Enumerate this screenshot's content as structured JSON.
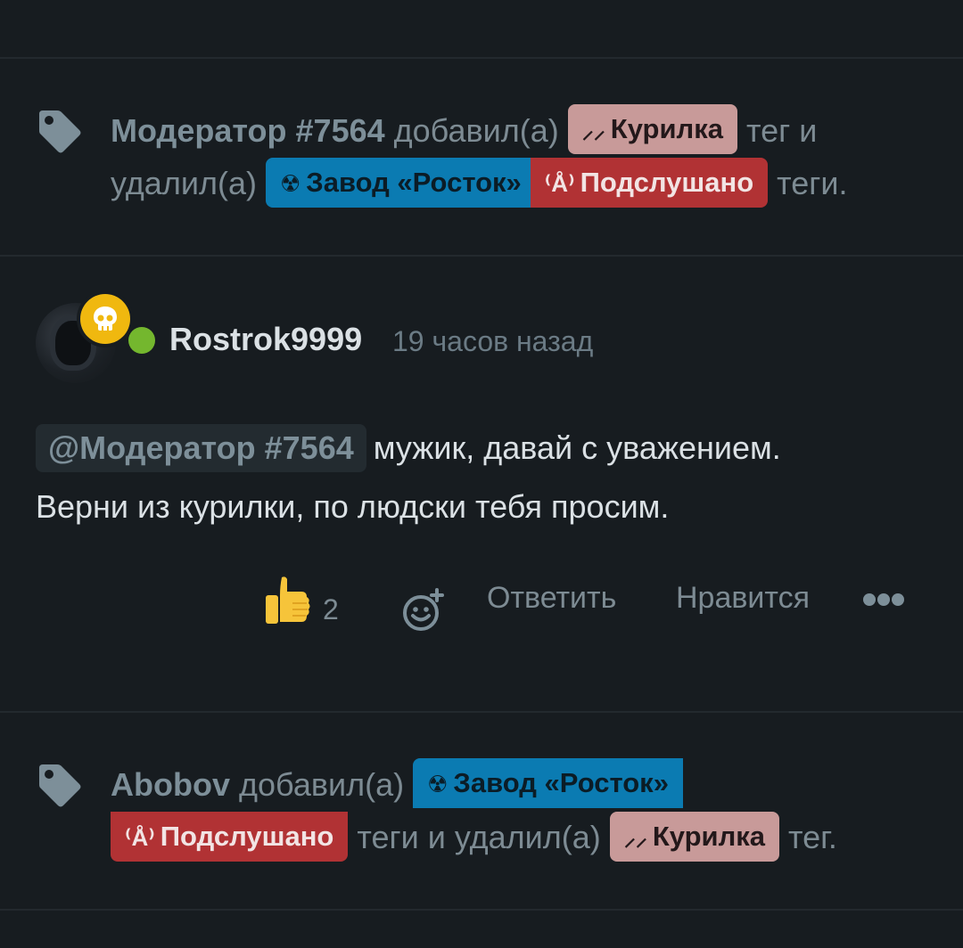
{
  "events": [
    {
      "actor": "Модератор #7564",
      "verb_added": "добавил(а)",
      "added_tags": [
        {
          "label": "Курилка",
          "icon": "cigarette-icon",
          "color": "#c89a99"
        }
      ],
      "connector_1": "тег и",
      "verb_removed": "удалил(а)",
      "removed_tags": [
        {
          "label": "Завод «Росток»",
          "icon": "radiation-icon",
          "color": "#0b7bb2"
        },
        {
          "label": "Подслушано",
          "icon": "radio-tower-icon",
          "color": "#b13234"
        }
      ],
      "suffix": "теги."
    },
    {
      "actor": "Abobov",
      "verb_added": "добавил(а)",
      "added_tags": [
        {
          "label": "Завод «Росток»",
          "icon": "radiation-icon",
          "color": "#0b7bb2"
        },
        {
          "label": "Подслушано",
          "icon": "radio-tower-icon",
          "color": "#b13234"
        }
      ],
      "connector_1": "теги и удалил(а)",
      "removed_tags": [
        {
          "label": "Курилка",
          "icon": "cigarette-icon",
          "color": "#c89a99"
        }
      ],
      "suffix": "тег."
    }
  ],
  "comment": {
    "username": "Rostrok9999",
    "timestamp": "19 часов назад",
    "badge_icon": "skull-icon",
    "online": true,
    "mention": "@Модератор #7564",
    "text_line1": "мужик, давай с уважением.",
    "text_line2": "Верни из курилки, по людски тебя просим.",
    "likes": "2",
    "reply_label": "Ответить",
    "like_label": "Нравится",
    "more_icon": "more-dots-icon"
  },
  "colors": {
    "background": "#171c20",
    "divider": "#23292e",
    "accent_online": "#74b72e",
    "badge": "#f0b80f"
  }
}
